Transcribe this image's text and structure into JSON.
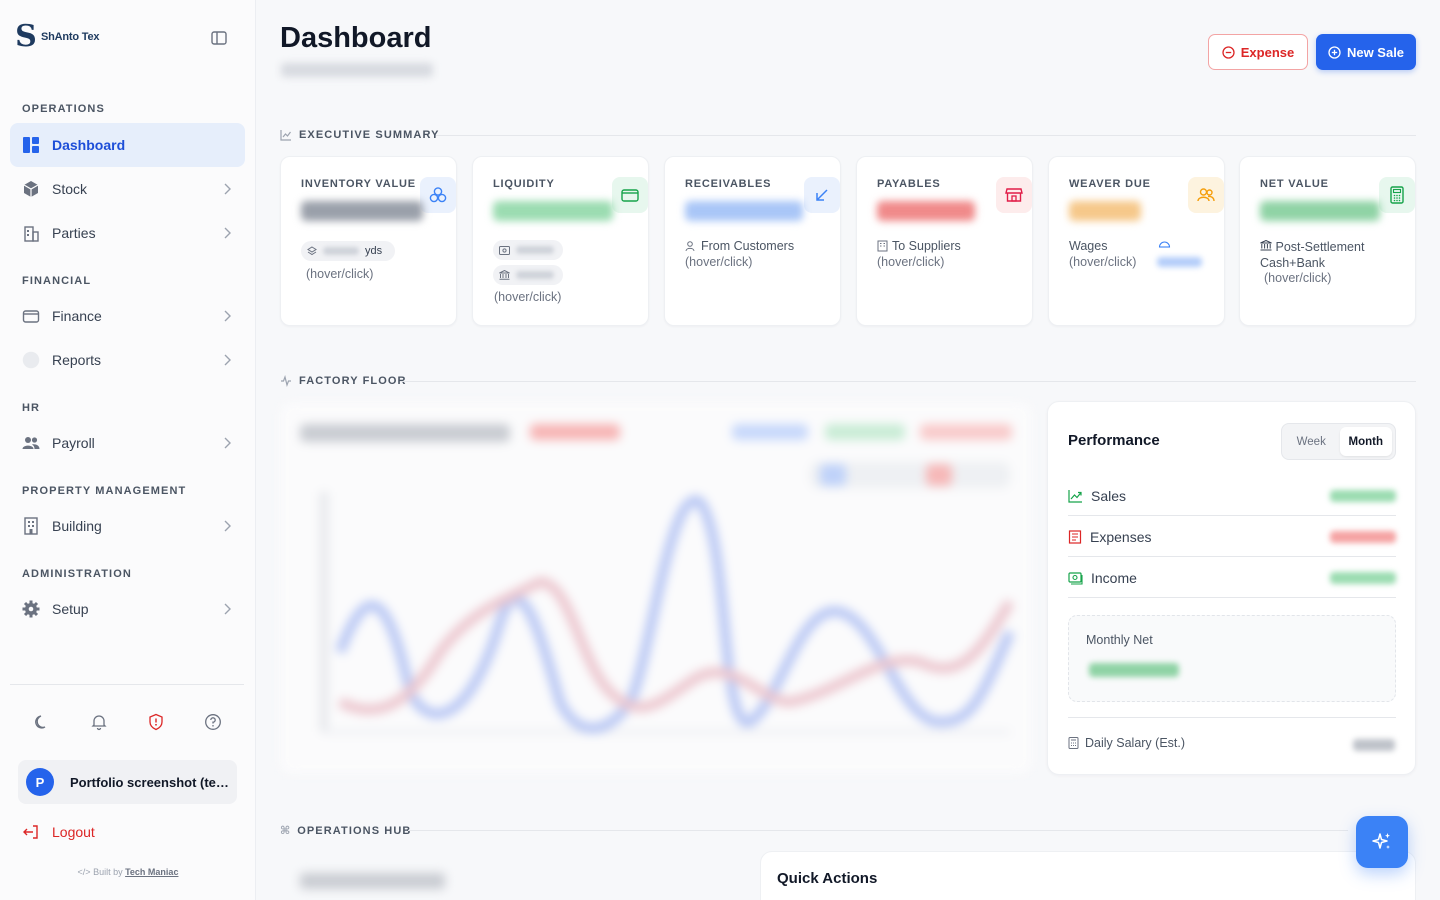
{
  "brand": {
    "name": "ShAnto Tex",
    "logo_letter": "S"
  },
  "sidebar": {
    "sections": {
      "operations": "OPERATIONS",
      "financial": "FINANCIAL",
      "hr": "HR",
      "property": "PROPERTY MANAGEMENT",
      "administration": "ADMINISTRATION"
    },
    "items": {
      "dashboard": "Dashboard",
      "stock": "Stock",
      "parties": "Parties",
      "finance": "Finance",
      "reports": "Reports",
      "payroll": "Payroll",
      "building": "Building",
      "setup": "Setup"
    },
    "active": "Dashboard",
    "user": {
      "initial": "P",
      "name": "Portfolio screenshot (tem..."
    },
    "logout": "Logout",
    "built_by_prefix": "Built by",
    "built_by_name": "Tech Maniac"
  },
  "header": {
    "title": "Dashboard",
    "expense_button": "Expense",
    "new_sale_button": "New Sale"
  },
  "executive_summary": {
    "heading": "EXECUTIVE SUMMARY",
    "cards": {
      "inventory": {
        "title": "INVENTORY VALUE",
        "unit": "yds",
        "hint": "(hover/click)"
      },
      "liquidity": {
        "title": "LIQUIDITY",
        "hint": "(hover/click)"
      },
      "receivables": {
        "title": "RECEIVABLES",
        "sub": "From Customers",
        "hint": "(hover/click)"
      },
      "payables": {
        "title": "PAYABLES",
        "sub": "To Suppliers",
        "hint": "(hover/click)"
      },
      "weaver": {
        "title": "WEAVER DUE",
        "sub": "Wages",
        "hint": "(hover/click)"
      },
      "net_value": {
        "title": "NET VALUE",
        "sub": "Post-Settlement Cash+Bank",
        "hint": "(hover/click)"
      }
    }
  },
  "factory_floor": {
    "heading": "FACTORY FLOOR"
  },
  "performance": {
    "title": "Performance",
    "toggle": {
      "week": "Week",
      "month": "Month",
      "selected": "Month"
    },
    "rows": {
      "sales": "Sales",
      "expenses": "Expenses",
      "income": "Income"
    },
    "monthly_net_label": "Monthly Net",
    "daily_salary_label": "Daily Salary (Est.)"
  },
  "operations_hub": {
    "heading": "OPERATIONS HUB",
    "quick_actions": "Quick Actions"
  },
  "colors": {
    "primary": "#2563eb",
    "danger": "#dc2626",
    "success": "#16a34a",
    "warning": "#f59e0b",
    "active_bg": "#e6eefb"
  }
}
